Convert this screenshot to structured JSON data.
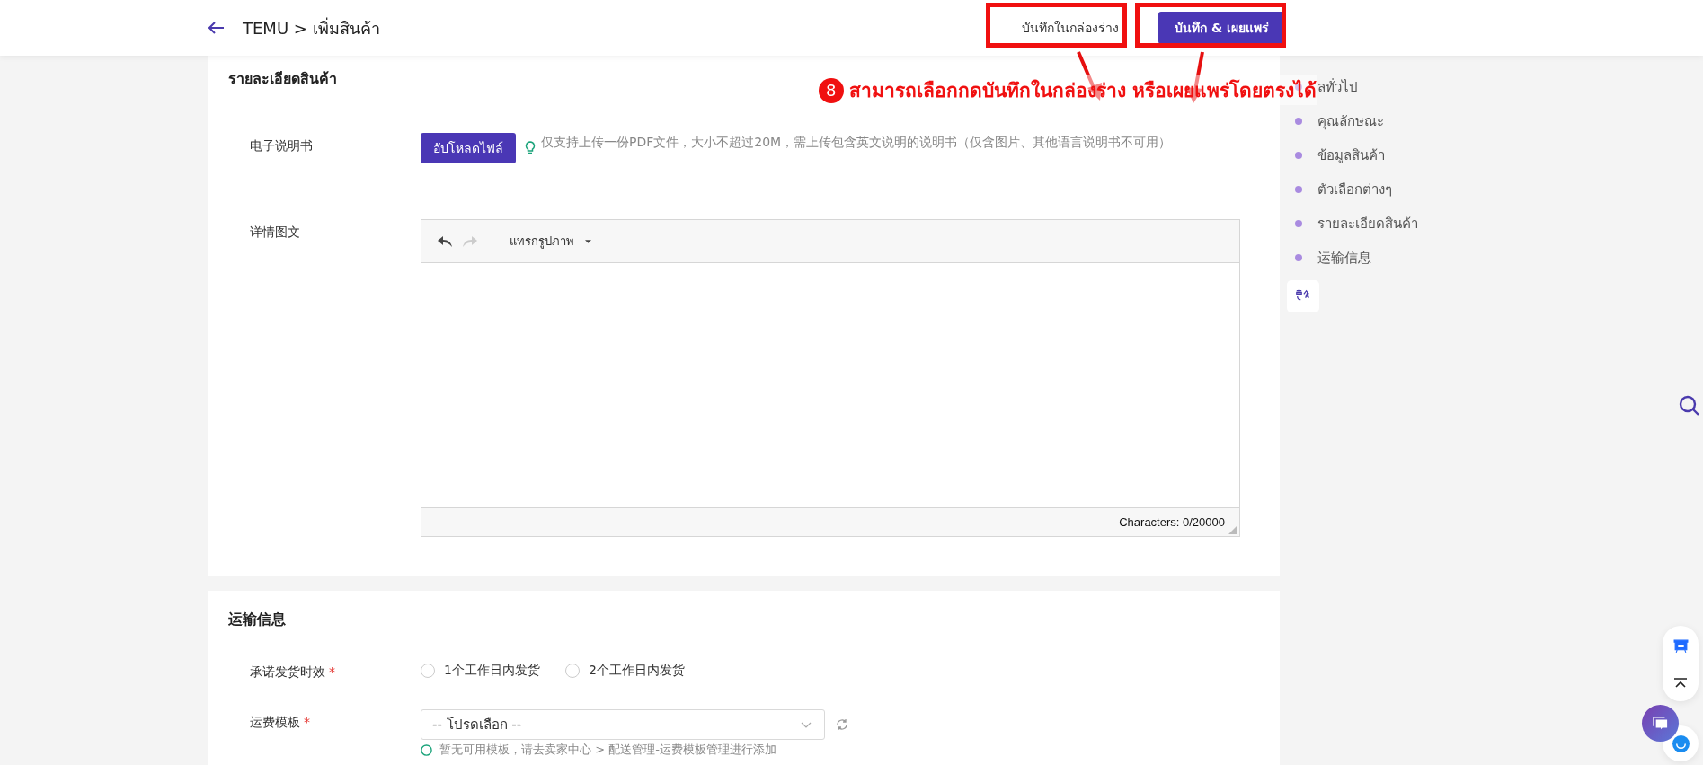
{
  "header": {
    "title": "TEMU > เพิ่มสินค้า",
    "buttons": [
      {
        "label": "บันทึกในกล่องร่าง",
        "kind": "secondary"
      },
      {
        "label": "บันทึก & เผยแพร่",
        "kind": "primary"
      }
    ]
  },
  "annotation": {
    "step": "8",
    "text": "สามารถเลือกกดบันทึกในกล่องร่าง หรือเผยแพร่โดยตรงได้"
  },
  "sections": [
    {
      "title": "รายละเอียดสินค้า",
      "fields": [
        {
          "kind": "upload",
          "label": "电子说明书",
          "button": "อัปโหลดไฟล์",
          "hint": "仅支持上传一份PDF文件，大小不超过20M，需上传包含英文说明的说明书（仅含图片、其他语言说明书不可用）"
        },
        {
          "kind": "editor",
          "label": "详情图文",
          "menu": "แทรกรูปภาพ",
          "counter": "Characters: 0/20000"
        }
      ]
    },
    {
      "title": "运输信息",
      "fields": [
        {
          "kind": "radio",
          "label": "承诺发货时效",
          "required_mark": "*",
          "options": [
            {
              "label": "1个工作日内发货",
              "selected": false
            },
            {
              "label": "2个工作日内发货",
              "selected": false
            }
          ]
        },
        {
          "kind": "select",
          "label": "运费模板",
          "required_mark": "*",
          "value": "-- โปรดเลือก --",
          "hint": "暂无可用模板，请去卖家中心 > 配送管理-运费模板管理进行添加"
        }
      ]
    }
  ],
  "nav": {
    "items": [
      {
        "label": "ลทั่วไป"
      },
      {
        "label": "คุณลักษณะ"
      },
      {
        "label": "ข้อมูลสินค้า"
      },
      {
        "label": "ตัวเลือกต่างๆ"
      },
      {
        "label": "รายละเอียดสินค้า"
      },
      {
        "label": "运输信息"
      }
    ]
  }
}
